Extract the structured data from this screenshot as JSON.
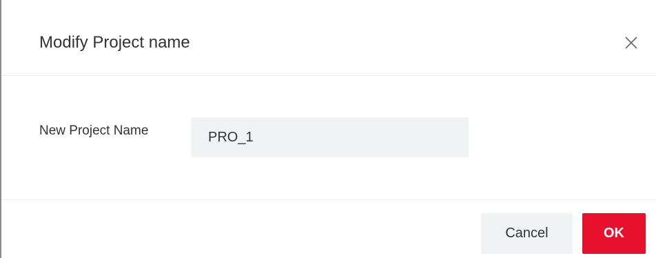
{
  "dialog": {
    "title": "Modify Project name",
    "close_icon": "close-icon"
  },
  "form": {
    "label": "New Project Name",
    "input_value": "PRO_1"
  },
  "footer": {
    "cancel_label": "Cancel",
    "ok_label": "OK"
  },
  "colors": {
    "primary": "#e8112d",
    "input_bg": "#f1f2f4",
    "text": "#333333",
    "divider": "#ececec"
  }
}
